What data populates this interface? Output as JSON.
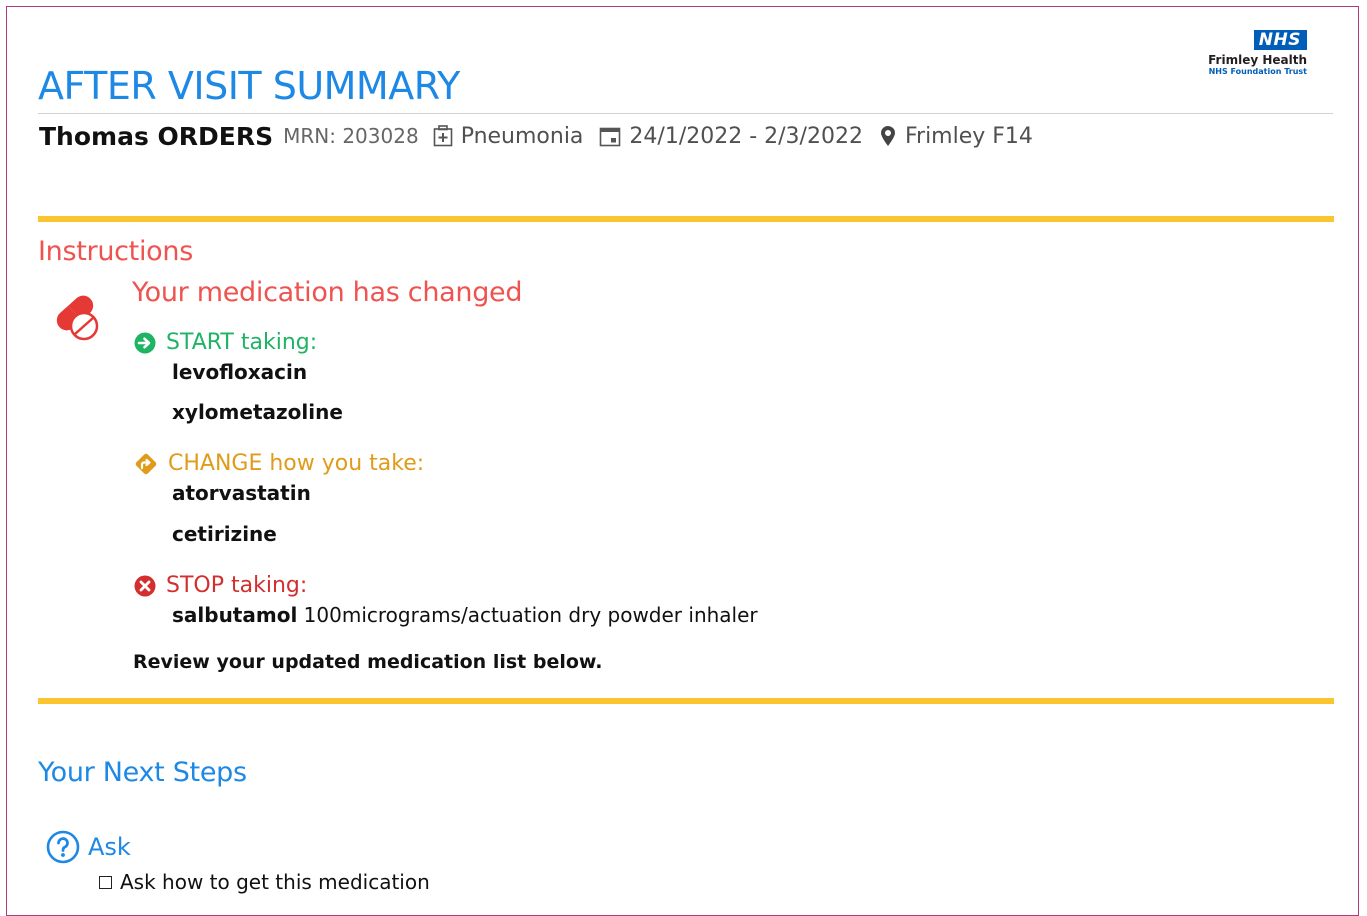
{
  "logo": {
    "badge": "NHS",
    "trust": "Frimley Health",
    "subtitle": "NHS Foundation Trust"
  },
  "header": {
    "title": "AFTER VISIT SUMMARY",
    "patient_name": "Thomas ORDERS",
    "mrn": "MRN: 203028",
    "diagnosis": "Pneumonia",
    "dates": "24/1/2022 - 2/3/2022",
    "location": "Frimley F14",
    "icons": [
      "hospital-icon",
      "calendar-icon",
      "location-pin-icon"
    ]
  },
  "instructions": {
    "heading": "Instructions",
    "icon": "pill-icon",
    "title": "Your medication has changed",
    "start": {
      "label": "START taking:",
      "color": "#1fb464",
      "icon": "arrow-right-circle-icon",
      "drugs": [
        "levofloxacin",
        "xylometazoline"
      ]
    },
    "change": {
      "label": "CHANGE how you take:",
      "color": "#e09b1a",
      "icon": "turn-diamond-icon",
      "drugs": [
        "atorvastatin",
        "cetirizine"
      ]
    },
    "stop": {
      "label": "STOP taking:",
      "color": "#d32f2f",
      "icon": "x-circle-icon",
      "drugs": [
        {
          "name": "salbutamol",
          "detail": "100micrograms/actuation dry powder inhaler"
        }
      ]
    },
    "review": "Review your updated medication list below."
  },
  "next_steps": {
    "heading": "Your Next Steps",
    "ask": {
      "label": "Ask",
      "icon": "question-circle-icon",
      "items": [
        "Ask how to get this medication"
      ]
    }
  },
  "colors": {
    "accent_blue": "#1e88e5",
    "heading_red": "#ef5350",
    "divider_yellow": "#fbc531",
    "frame_border": "#b03a7a",
    "nhs_blue": "#005eb8"
  }
}
